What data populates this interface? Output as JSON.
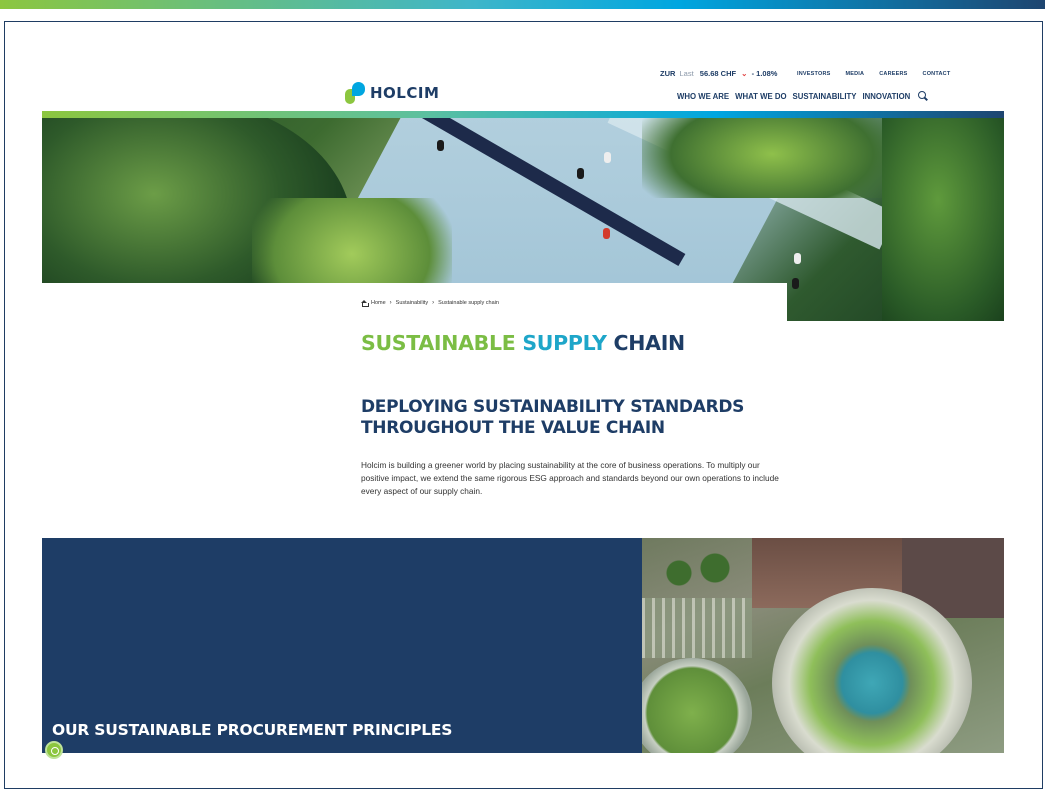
{
  "header": {
    "logo_text": "HOLCIM",
    "ticker": {
      "symbol": "ZUR",
      "label": "Last",
      "value": "56.68 CHF",
      "arrow": "⌄",
      "change": "- 1.08%"
    },
    "utility_links": [
      "INVESTORS",
      "MEDIA",
      "CAREERS",
      "CONTACT"
    ],
    "main_nav": [
      "WHO WE ARE",
      "WHAT WE DO",
      "SUSTAINABILITY",
      "INNOVATION"
    ]
  },
  "breadcrumb": {
    "home": "Home",
    "sep": "›",
    "level1": "Sustainability",
    "current": "Sustainable supply chain"
  },
  "page_title": {
    "part1": "SUSTAINABLE",
    "part2": "SUPPLY",
    "part3": "CHAIN"
  },
  "section": {
    "heading": "DEPLOYING SUSTAINABILITY STANDARDS THROUGHOUT THE VALUE CHAIN",
    "body": "Holcim is building a greener world by placing sustainability at the core of business operations. To multiply our positive impact, we extend the same rigorous ESG approach and standards beyond our own operations to include every aspect of our supply chain."
  },
  "principles_block": {
    "title": "OUR SUSTAINABLE PROCUREMENT PRINCIPLES"
  },
  "colors": {
    "navy": "#1e3d66",
    "green": "#7bbd44",
    "teal": "#1ea6c9",
    "down": "#e03a3a"
  }
}
